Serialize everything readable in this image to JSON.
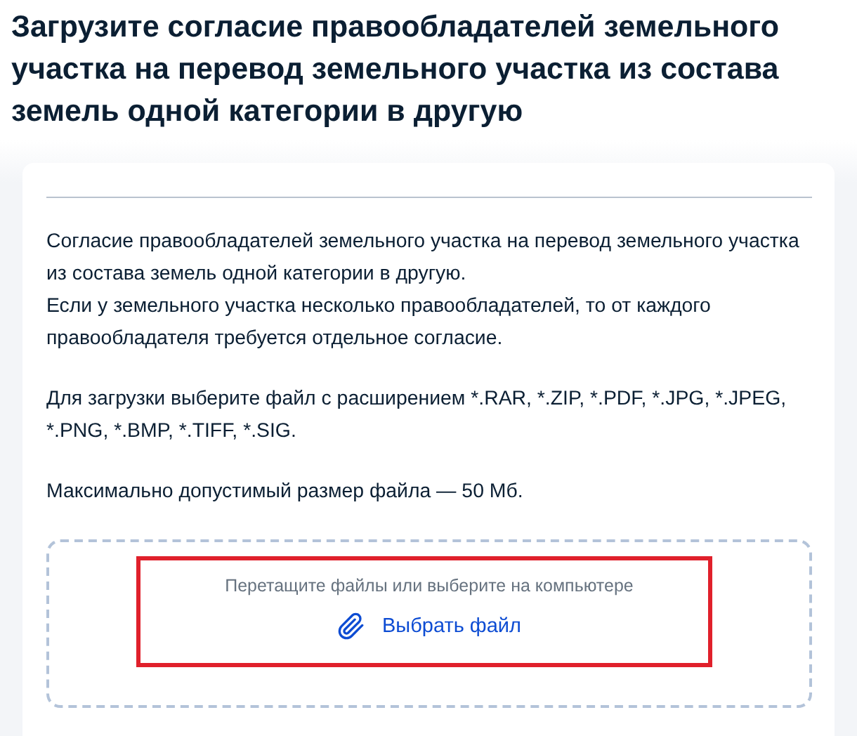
{
  "title": "Загрузите согласие правообладателей земельного участка на перевод земельного участка из состава земель одной категории в другую",
  "paragraphs": [
    {
      "lines": [
        "Согласие правообладателей земельного участка на перевод земельного участка из состава земель одной категории в другую.",
        "Если у земельного участка несколько правообладателей, то от каждого правообладателя требуется отдельное согласие."
      ]
    },
    {
      "lines": [
        "Для загрузки выберите файл с расширением *.RAR, *.ZIP, *.PDF, *.JPG, *.JPEG, *.PNG, *.BMP, *.TIFF, *.SIG."
      ]
    },
    {
      "lines": [
        "Максимально допустимый размер файла — 50 Мб."
      ]
    }
  ],
  "dropzone": {
    "hint": "Перетащите файлы или выберите на компьютере",
    "button": "Выбрать файл"
  }
}
